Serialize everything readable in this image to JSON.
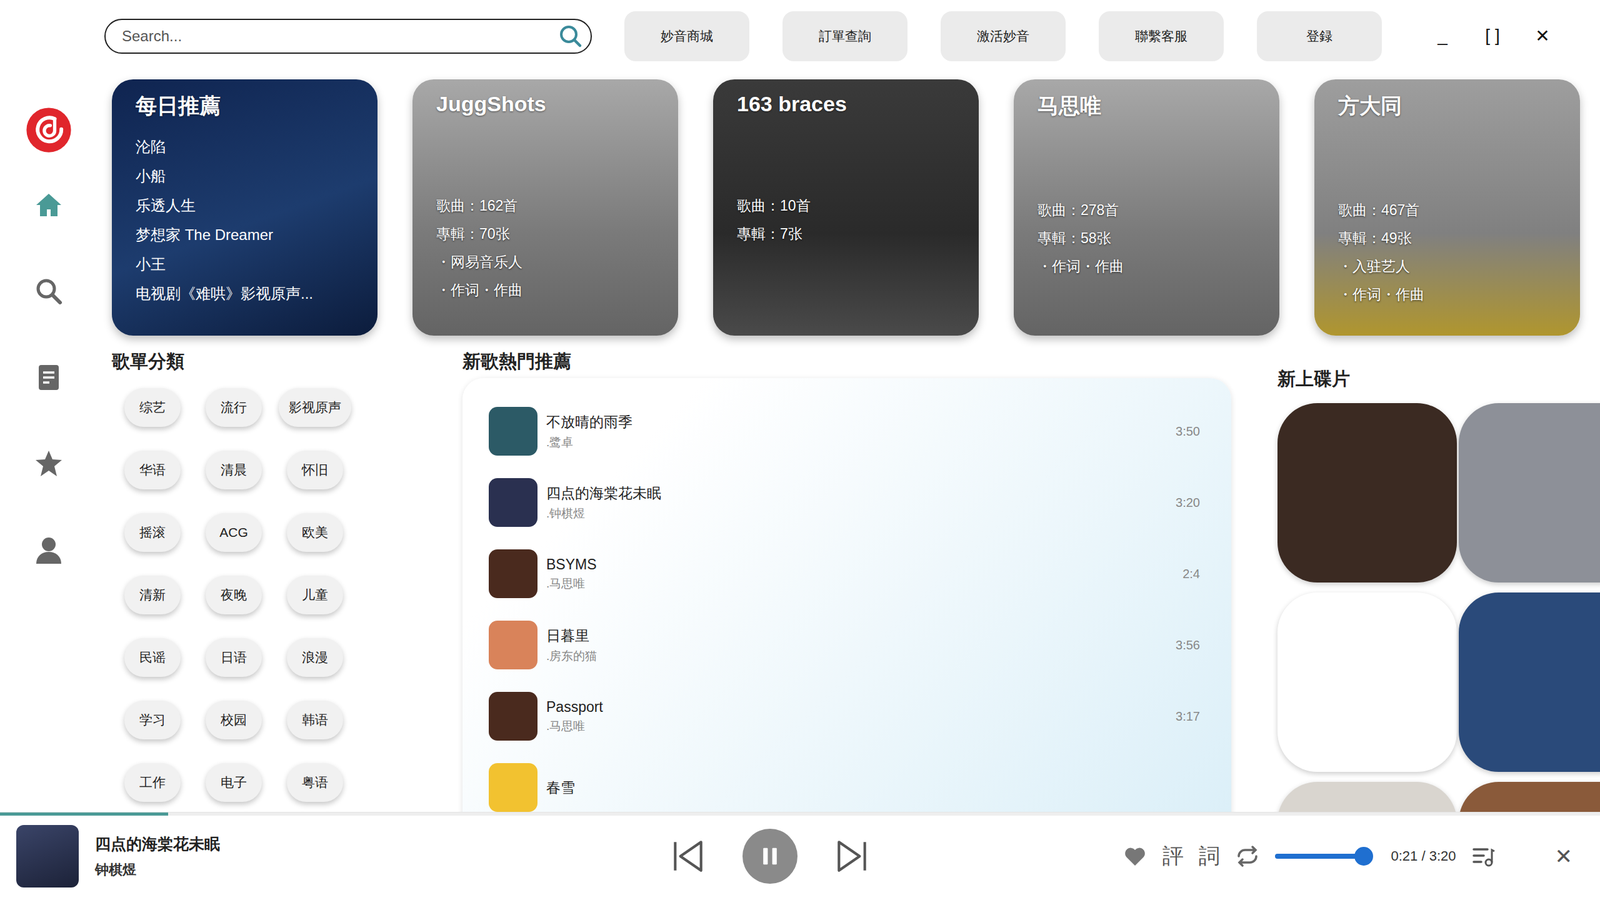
{
  "window": {
    "controls": [
      "_",
      "[ ]",
      "✕"
    ]
  },
  "search": {
    "placeholder": "Search..."
  },
  "top_buttons": [
    "妙音商城",
    "訂單查詢",
    "激活妙音",
    "聯繫客服",
    "登録"
  ],
  "sidebar": {
    "items": [
      {
        "kind": "home",
        "selected": true
      },
      {
        "kind": "search",
        "selected": false
      },
      {
        "kind": "list",
        "selected": false
      },
      {
        "kind": "star",
        "selected": false
      },
      {
        "kind": "user",
        "selected": false
      }
    ]
  },
  "daily": {
    "title": "每日推薦",
    "songs": [
      "沦陷",
      "小船",
      "乐透人生",
      "梦想家 The Dreamer",
      "小王",
      "电视剧《难哄》影视原声..."
    ]
  },
  "artists": [
    {
      "name": "JuggShots",
      "lines": [
        "歌曲：162首",
        "專輯：70张",
        "・网易音乐人",
        "・作词・作曲"
      ]
    },
    {
      "name": "163 braces",
      "lines": [
        "歌曲：10首",
        "專輯：7张"
      ]
    },
    {
      "name": "马思唯",
      "lines": [
        "歌曲：278首",
        "專輯：58张",
        "・作词・作曲"
      ]
    },
    {
      "name": "方大同",
      "lines": [
        "歌曲：467首",
        "專輯：49张",
        "・入驻艺人",
        "・作词・作曲"
      ]
    }
  ],
  "categories": {
    "title": "歌單分類",
    "items": [
      "综艺",
      "流行",
      "影视原声",
      "华语",
      "清晨",
      "怀旧",
      "摇滚",
      "ACG",
      "欧美",
      "清新",
      "夜晚",
      "儿童",
      "民谣",
      "日语",
      "浪漫",
      "学习",
      "校园",
      "韩语",
      "工作",
      "电子",
      "粤语"
    ]
  },
  "new_songs": {
    "title": "新歌熱門推薦",
    "rows": [
      {
        "title": "不放晴的雨季",
        "artist": ".鹭卓",
        "duration": "3:50",
        "color": "#2c5a66"
      },
      {
        "title": "四点的海棠花未眠",
        "artist": ".钟棋煜",
        "duration": "3:20",
        "color": "#2a3050"
      },
      {
        "title": "BSYMS",
        "artist": ".马思唯",
        "duration": "2:4",
        "color": "#4a2a1e"
      },
      {
        "title": "日暮里",
        "artist": ".房东的猫",
        "duration": "3:56",
        "color": "#d9835a"
      },
      {
        "title": "Passport",
        "artist": ".马思唯",
        "duration": "3:17",
        "color": "#4a2a1e"
      },
      {
        "title": "春雪",
        "color": "#f2c230"
      }
    ]
  },
  "new_discs": {
    "title": "新上碟片",
    "items": [
      {
        "color": "#3b2a22"
      },
      {
        "color": "#8d9098"
      },
      {
        "color": "#ffffff"
      },
      {
        "color": "#2a4a7a"
      },
      {
        "color": "#d9d5cf"
      },
      {
        "color": "#8a5a3a"
      }
    ]
  },
  "player": {
    "title": "四点的海棠花未眠",
    "artist": "钟棋煜",
    "progress": 0.105,
    "playing": true,
    "liked": false,
    "buttons": [
      "評",
      "詞"
    ],
    "volume": 0.95,
    "time": "0:21 / 3:20",
    "close": "✕"
  }
}
